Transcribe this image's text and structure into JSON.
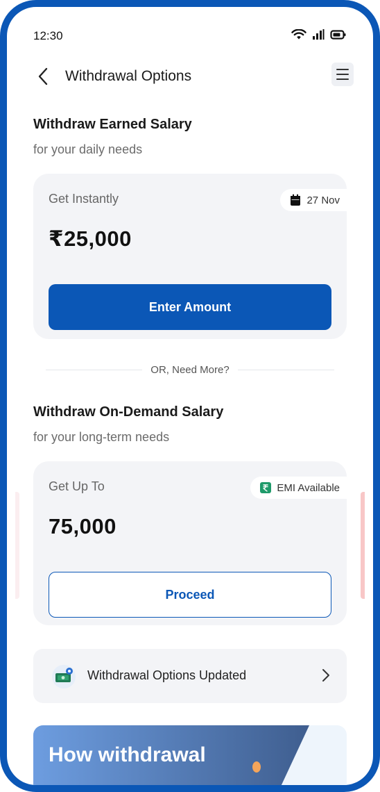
{
  "status_bar": {
    "time": "12:30"
  },
  "header": {
    "title": "Withdrawal Options"
  },
  "earned": {
    "title": "Withdraw Earned Salary",
    "subtitle": "for your daily needs",
    "card_label": "Get Instantly",
    "amount": "₹25,000",
    "date_badge": "27 Nov",
    "button_label": "Enter Amount"
  },
  "divider": {
    "text": "OR, Need More?"
  },
  "ondemand": {
    "title": "Withdraw On-Demand Salary",
    "subtitle": "for your long-term needs",
    "card_label": "Get Up To",
    "amount": "75,000",
    "badge": "EMI Available",
    "button_label": "Proceed"
  },
  "notice": {
    "text": "Withdrawal Options Updated"
  },
  "banner": {
    "title": "How withdrawal"
  },
  "colors": {
    "primary": "#0b57b6",
    "card_bg": "#f3f4f7",
    "emi_green": "#1f9a6a"
  }
}
